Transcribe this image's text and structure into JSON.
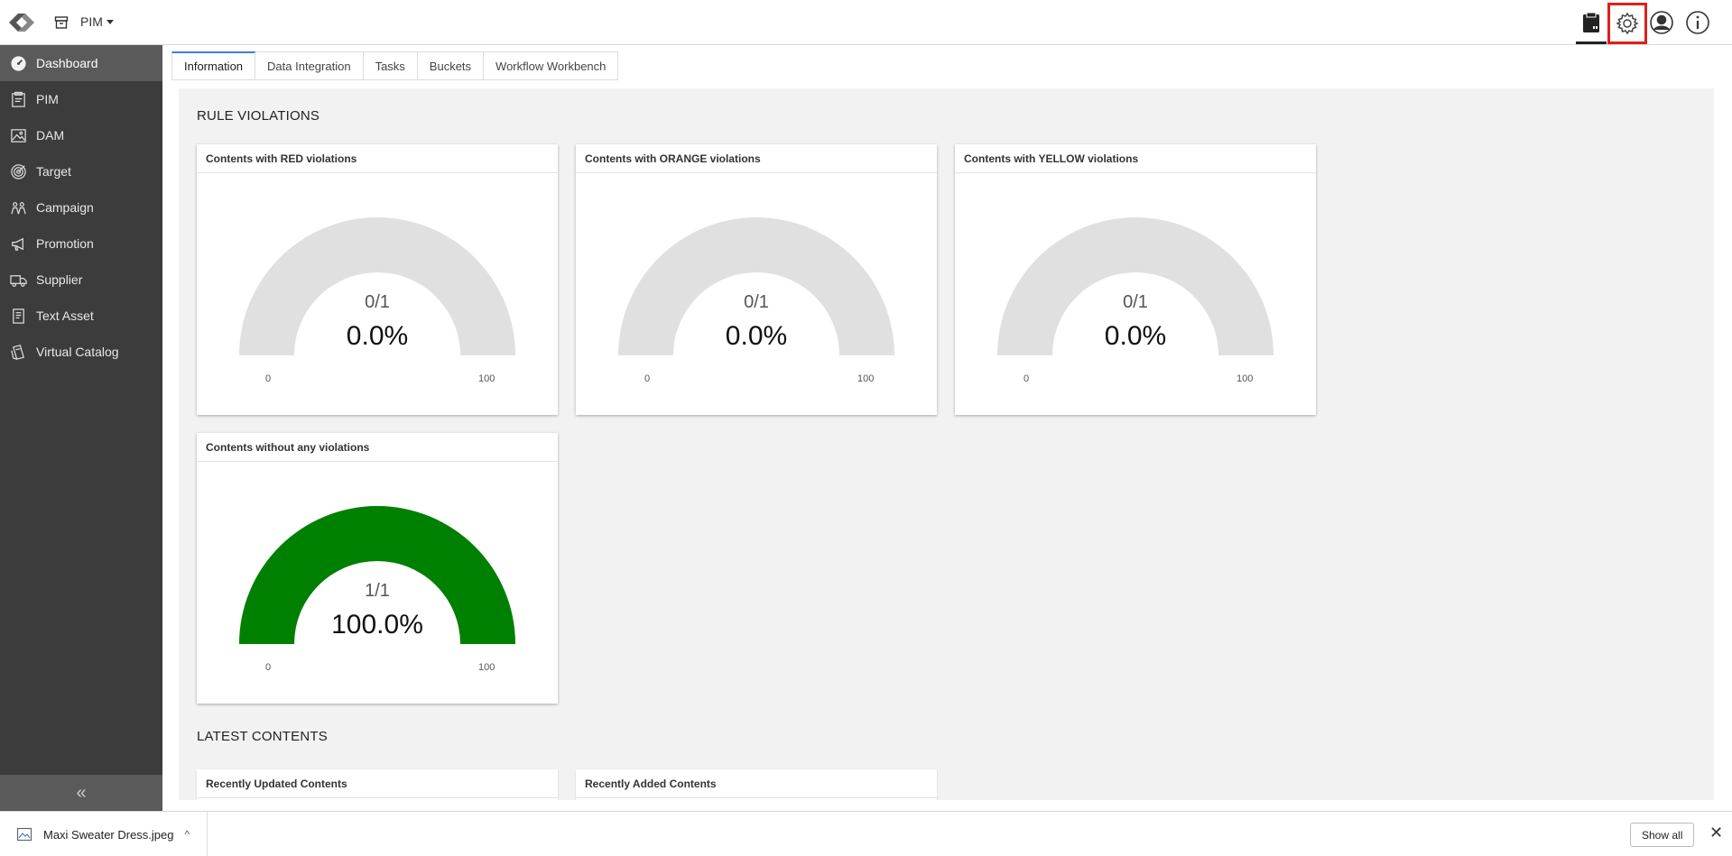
{
  "header": {
    "module_name": "PIM",
    "icons": [
      "clipboard-icon",
      "gear-icon",
      "user-icon",
      "info-icon"
    ]
  },
  "sidebar": {
    "items": [
      {
        "label": "Dashboard",
        "icon": "dashboard-icon",
        "active": true
      },
      {
        "label": "PIM",
        "icon": "pim-icon"
      },
      {
        "label": "DAM",
        "icon": "image-icon"
      },
      {
        "label": "Target",
        "icon": "target-icon"
      },
      {
        "label": "Campaign",
        "icon": "campaign-icon"
      },
      {
        "label": "Promotion",
        "icon": "megaphone-icon"
      },
      {
        "label": "Supplier",
        "icon": "truck-icon"
      },
      {
        "label": "Text Asset",
        "icon": "document-icon"
      },
      {
        "label": "Virtual Catalog",
        "icon": "catalog-icon"
      }
    ],
    "collapse_glyph": "«"
  },
  "tabs": [
    {
      "label": "Information",
      "active": true
    },
    {
      "label": "Data Integration"
    },
    {
      "label": "Tasks"
    },
    {
      "label": "Buckets"
    },
    {
      "label": "Workflow Workbench"
    }
  ],
  "rule_violations": {
    "title": "RULE VIOLATIONS",
    "cards": [
      {
        "title": "Contents with RED violations",
        "count": "0/1",
        "percent": "0.0%",
        "value": 0.0,
        "min": "0",
        "max": "100",
        "fill_color": "#008000"
      },
      {
        "title": "Contents with ORANGE violations",
        "count": "0/1",
        "percent": "0.0%",
        "value": 0.0,
        "min": "0",
        "max": "100",
        "fill_color": "#008000"
      },
      {
        "title": "Contents with YELLOW violations",
        "count": "0/1",
        "percent": "0.0%",
        "value": 0.0,
        "min": "0",
        "max": "100",
        "fill_color": "#008000"
      },
      {
        "title": "Contents without any violations",
        "count": "1/1",
        "percent": "100.0%",
        "value": 100.0,
        "min": "0",
        "max": "100",
        "fill_color": "#008000"
      }
    ]
  },
  "latest_contents": {
    "title": "LATEST CONTENTS",
    "cards": [
      {
        "title": "Recently Updated Contents"
      },
      {
        "title": "Recently Added Contents"
      }
    ]
  },
  "download_bar": {
    "file_name": "Maxi Sweater Dress.jpeg",
    "chevron": "^",
    "show_all": "Show all",
    "close": "✕"
  },
  "colors": {
    "gauge_track": "#e0e0e0",
    "gauge_fill": "#008000",
    "sidebar_bg": "#3c3c3c",
    "tab_accent": "#3f7ee8",
    "highlight": "#e01e1e"
  }
}
